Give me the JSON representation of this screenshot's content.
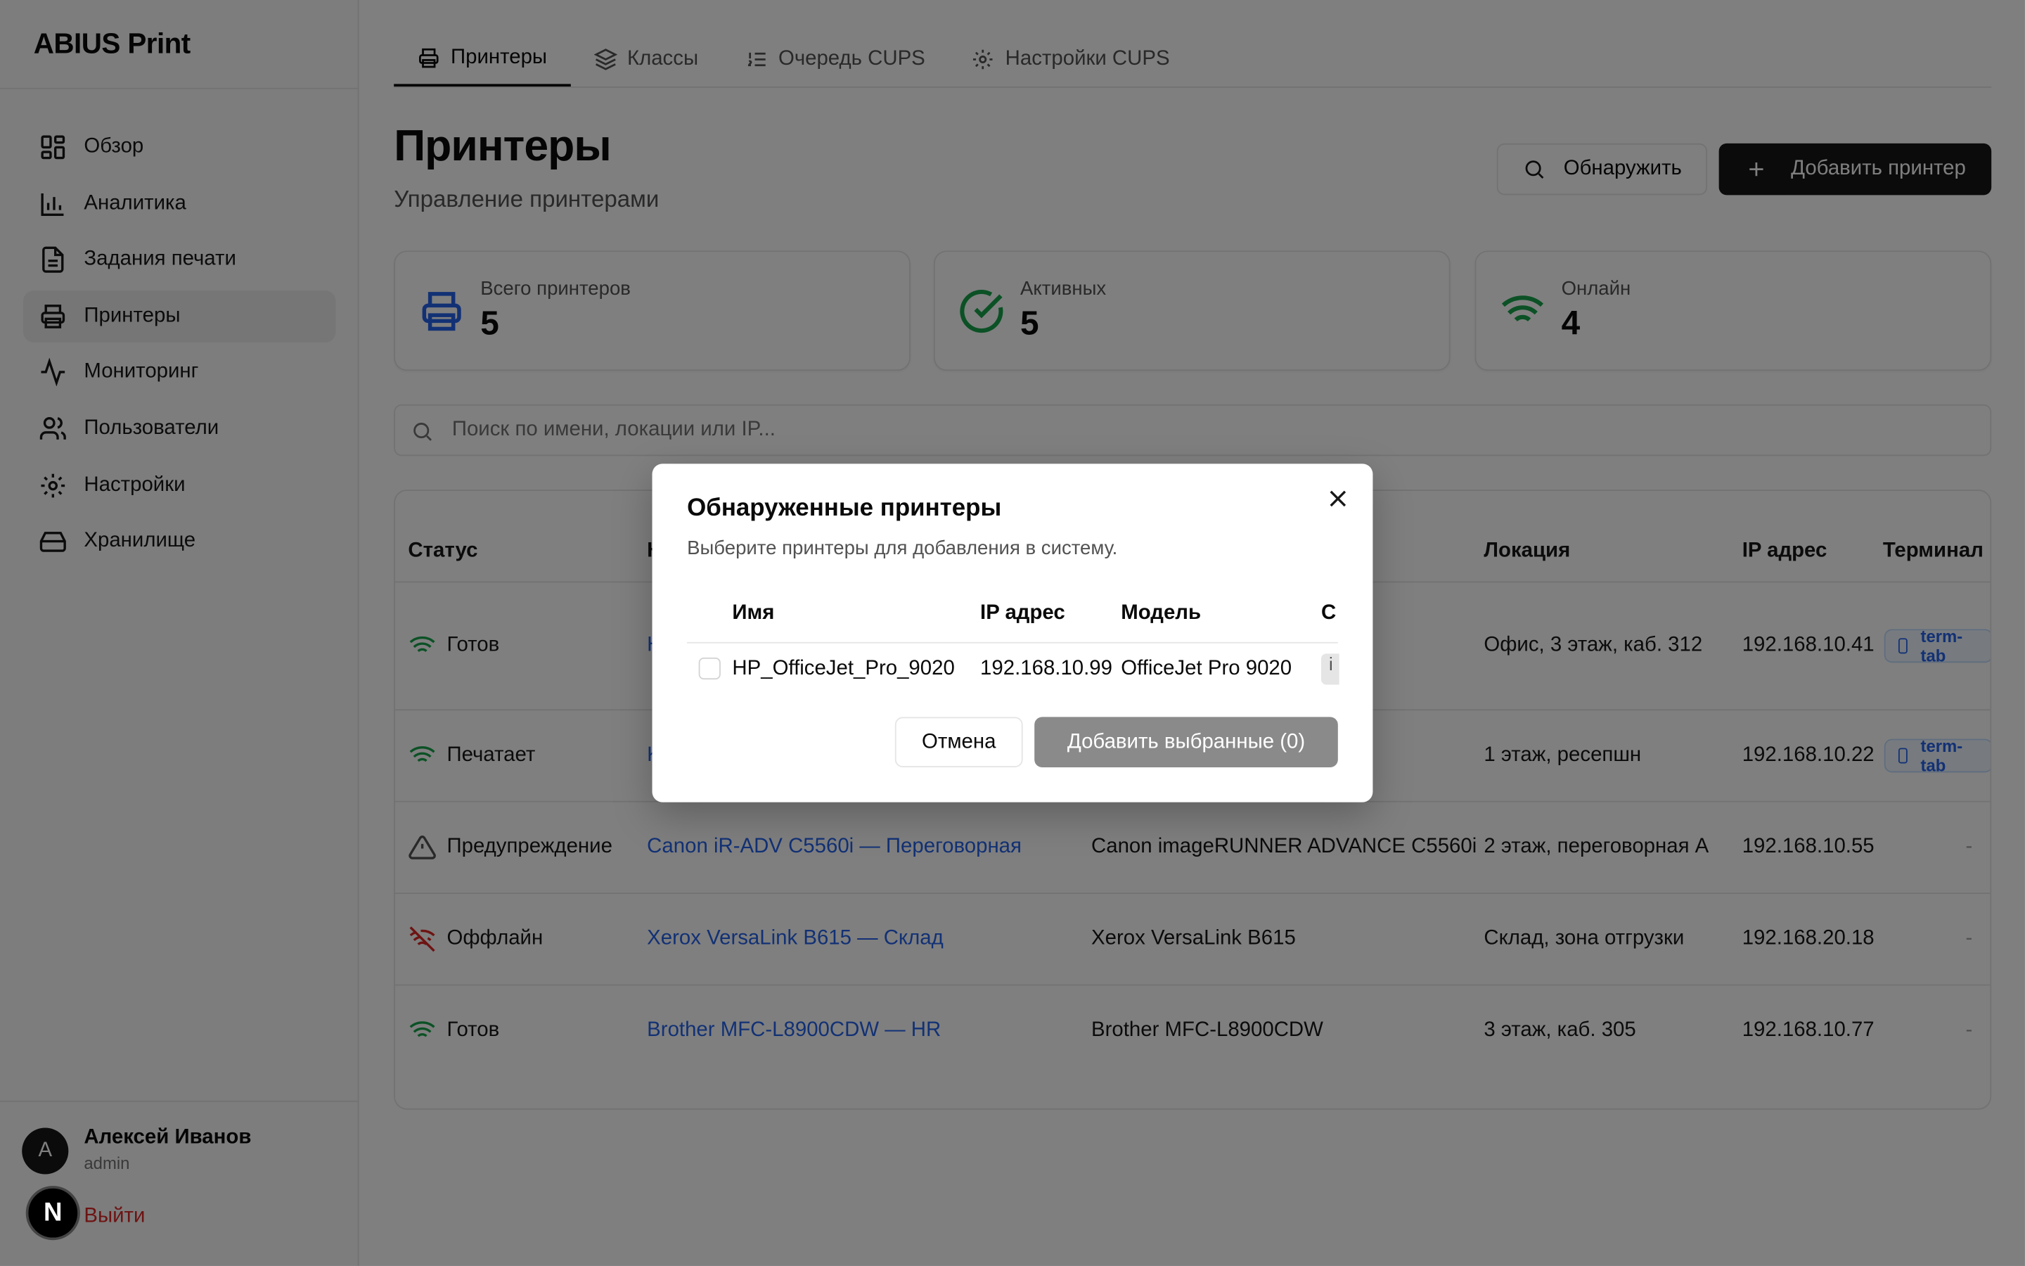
{
  "brand": "ABIUS Print",
  "sidebar": {
    "items": [
      {
        "label": "Обзор",
        "icon": "dashboard-grid-icon"
      },
      {
        "label": "Аналитика",
        "icon": "bar-chart-icon"
      },
      {
        "label": "Задания печати",
        "icon": "document-icon"
      },
      {
        "label": "Принтеры",
        "icon": "printer-icon",
        "active": true
      },
      {
        "label": "Мониторинг",
        "icon": "activity-icon"
      },
      {
        "label": "Пользователи",
        "icon": "users-icon"
      },
      {
        "label": "Настройки",
        "icon": "gear-icon"
      },
      {
        "label": "Хранилище",
        "icon": "storage-icon"
      }
    ],
    "user": {
      "initial": "A",
      "name": "Алексей Иванов",
      "role": "admin"
    },
    "overlay_badge": "N",
    "logout": "Выйти"
  },
  "tabs": [
    {
      "label": "Принтеры",
      "icon": "printer-icon",
      "active": true
    },
    {
      "label": "Классы",
      "icon": "layers-icon"
    },
    {
      "label": "Очередь CUPS",
      "icon": "list-ordered-icon"
    },
    {
      "label": "Настройки CUPS",
      "icon": "gear-icon"
    }
  ],
  "page": {
    "title": "Принтеры",
    "subtitle": "Управление принтерами",
    "discover_label": "Обнаружить",
    "add_label": "Добавить принтер"
  },
  "stats": [
    {
      "label": "Всего принтеров",
      "value": "5",
      "icon": "printer-icon",
      "color": "#2563eb"
    },
    {
      "label": "Активных",
      "value": "5",
      "icon": "check-circle-icon",
      "color": "#16a34a"
    },
    {
      "label": "Онлайн",
      "value": "4",
      "icon": "wifi-icon",
      "color": "#16a34a"
    }
  ],
  "search": {
    "placeholder": "Поиск по имени, локации или IP..."
  },
  "table": {
    "headers": {
      "status": "Статус",
      "name": "Н",
      "location": "Локация",
      "ip": "IP адрес",
      "terminal": "Терминал"
    },
    "rows": [
      {
        "status": "Готов",
        "status_icon": "wifi-icon",
        "name": "H",
        "model": "",
        "location": "Офис, 3 этаж, каб. 312",
        "ip": "192.168.10.41",
        "terminal": "term-tab"
      },
      {
        "status": "Печатает",
        "status_icon": "wifi-icon",
        "name": "K",
        "model": "",
        "location": "1 этаж, ресепшн",
        "ip": "192.168.10.22",
        "terminal": "term-tab"
      },
      {
        "status": "Предупреждение",
        "status_icon": "warning-triangle-icon",
        "name": "Canon iR-ADV C5560i — Переговорная",
        "model": "Canon imageRUNNER ADVANCE C5560i",
        "location": "2 этаж, переговорная А",
        "ip": "192.168.10.55",
        "terminal": "-"
      },
      {
        "status": "Оффлайн",
        "status_icon": "wifi-off-icon",
        "name": "Xerox VersaLink B615 — Склад",
        "model": "Xerox VersaLink B615",
        "location": "Склад, зона отгрузки",
        "ip": "192.168.20.18",
        "terminal": "-"
      },
      {
        "status": "Готов",
        "status_icon": "wifi-icon",
        "name": "Brother MFC-L8900CDW — HR",
        "model": "Brother MFC-L8900CDW",
        "location": "3 этаж, каб. 305",
        "ip": "192.168.10.77",
        "terminal": "-"
      }
    ]
  },
  "modal": {
    "title": "Обнаруженные принтеры",
    "description": "Выберите принтеры для добавления в систему.",
    "headers": {
      "name": "Имя",
      "ip": "IP адрес",
      "model": "Модель",
      "extra": "С"
    },
    "rows": [
      {
        "name": "HP_OfficeJet_Pro_9020",
        "ip": "192.168.10.99",
        "model": "OfficeJet Pro 9020",
        "chip": "i"
      }
    ],
    "cancel_label": "Отмена",
    "add_label": "Добавить выбранные (0)"
  },
  "colors": {
    "accent": "#171717",
    "link": "#2563eb",
    "ok": "#16a34a",
    "danger": "#dc2626"
  }
}
